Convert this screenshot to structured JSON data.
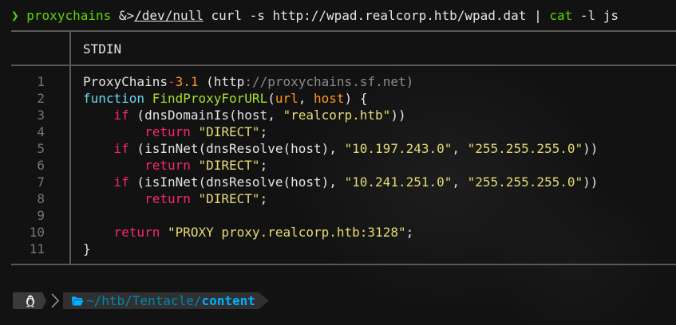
{
  "command": {
    "prompt_symbol": "❯",
    "part1": "proxychains",
    "part2": " &>",
    "part3": "/dev/null",
    "part4": " curl -s http://wpad.realcorp.htb/wpad.dat | ",
    "part5": "cat",
    "part6": " -l js"
  },
  "bat": {
    "section_label": "STDIN",
    "line_numbers": [
      "1",
      "2",
      "3",
      "4",
      "5",
      "6",
      "7",
      "8",
      "9",
      "10",
      "11"
    ],
    "code": {
      "l1": [
        "ProxyChains",
        "-",
        "3.1",
        " (http",
        "://proxychains.sf.net)"
      ],
      "l2": [
        "function",
        " ",
        "FindProxyForURL",
        "(",
        "url",
        ", ",
        "host",
        ") {"
      ],
      "l3": [
        "    ",
        "if",
        " (dnsDomainIs(host, ",
        "\"realcorp.htb\"",
        "))"
      ],
      "l4": [
        "        ",
        "return",
        " ",
        "\"DIRECT\"",
        ";"
      ],
      "l5": [
        "    ",
        "if",
        " (isInNet(dnsResolve(host), ",
        "\"10.197.243.0\"",
        ", ",
        "\"255.255.255.0\"",
        "))"
      ],
      "l6": [
        "        ",
        "return",
        " ",
        "\"DIRECT\"",
        ";"
      ],
      "l7": [
        "    ",
        "if",
        " (isInNet(dnsResolve(host), ",
        "\"10.241.251.0\"",
        ", ",
        "\"255.255.255.0\"",
        "))"
      ],
      "l8": [
        "        ",
        "return",
        " ",
        "\"DIRECT\"",
        ";"
      ],
      "l9": [
        ""
      ],
      "l10": [
        "    ",
        "return",
        " ",
        "\"PROXY proxy.realcorp.htb:3128\"",
        ";"
      ],
      "l11": [
        "}"
      ]
    }
  },
  "status": {
    "os_icon": "linux-tux-icon",
    "folder_icon": "folder-open-icon",
    "path_dim": "~/htb/Tentacle/",
    "path_bold": "content"
  },
  "colors": {
    "prompt_green": "#5fd700",
    "keyword_pink": "#f92672",
    "func_green": "#a6e22e",
    "param_orange": "#fd971f",
    "string_yellow": "#e6db74",
    "type_blue": "#66d9ef",
    "path_blue": "#00afff"
  }
}
